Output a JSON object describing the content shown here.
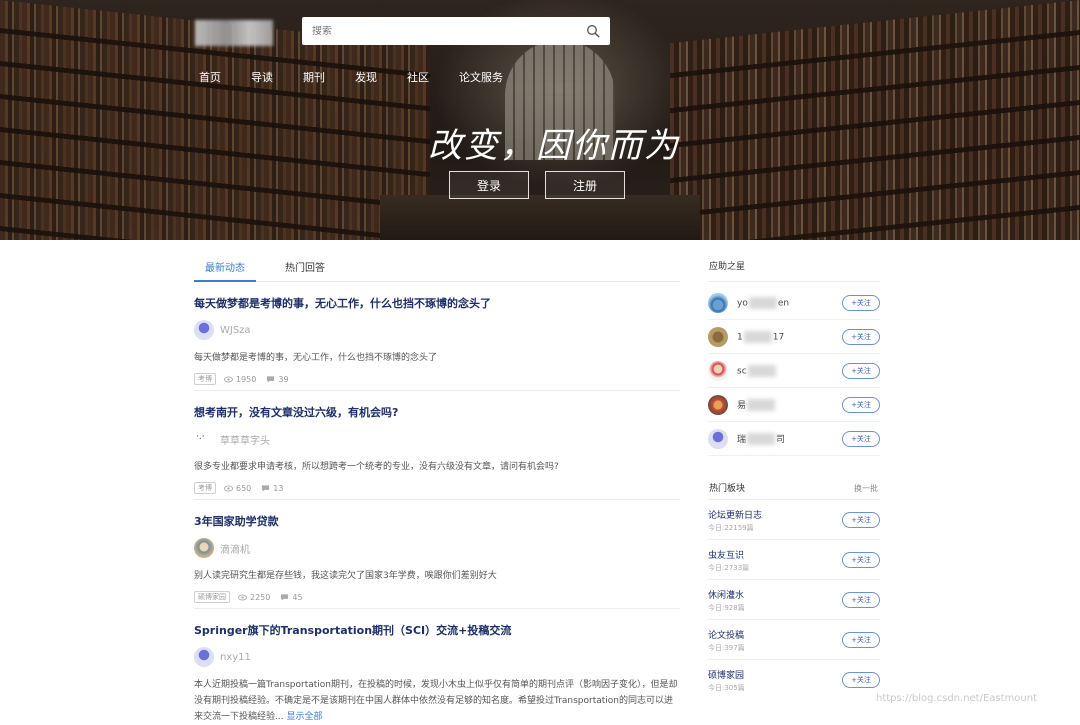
{
  "search": {
    "placeholder": "搜索"
  },
  "nav": [
    {
      "label": "首页"
    },
    {
      "label": "导读"
    },
    {
      "label": "期刊"
    },
    {
      "label": "发现"
    },
    {
      "label": "社区"
    },
    {
      "label": "论文服务"
    }
  ],
  "hero": {
    "slogan": "改变，因你而为",
    "login_label": "登录",
    "register_label": "注册"
  },
  "tabs": [
    {
      "label": "最新动态",
      "active": true
    },
    {
      "label": "热门回答",
      "active": false
    }
  ],
  "posts": [
    {
      "title": "每天做梦都是考博的事，无心工作，什么也挡不琢博的念头了",
      "author": "WJSza",
      "excerpt": "每天做梦都是考博的事，无心工作，什么也挡不琢博的念头了",
      "tag": "考博",
      "views": "1950",
      "comments": "39"
    },
    {
      "title": "想考南开，没有文章没过六级，有机会吗?",
      "author": "草草草字头",
      "excerpt": "很多专业都要求申请考核，所以想跨考一个统考的专业，没有六级没有文章，请问有机会吗?",
      "tag": "考博",
      "views": "650",
      "comments": "13"
    },
    {
      "title": "3年国家助学贷款",
      "author": "滴滴机",
      "excerpt": "别人读完研究生都是存些钱，我这读完欠了国家3年学费，唉跟你们差别好大",
      "tag": "硕博家园",
      "views": "2250",
      "comments": "45"
    },
    {
      "title": "Springer旗下的Transportation期刊（SCI）交流+投稿交流",
      "author": "nxy11",
      "excerpt": "本人近期投稿一篇Transportation期刊，在投稿的时候，发现小木虫上似乎仅有简单的期刊点评（影响因子变化），但是却没有期刊投稿经验。不确定是不是该期刊在中国人群体中依然没有足够的知名度。希望投过Transportation的同志可以进来交流一下投稿经验...",
      "more": "显示全部"
    }
  ],
  "sidebar": {
    "helpers_title": "应助之星",
    "helpers": [
      {
        "name_prefix": "yo",
        "name_suffix": "en",
        "follow": "+关注"
      },
      {
        "name_prefix": "1",
        "name_suffix": "17",
        "follow": "+关注"
      },
      {
        "name_prefix": "sc",
        "name_suffix": "",
        "follow": "+关注"
      },
      {
        "name_prefix": "易",
        "name_suffix": "",
        "follow": "+关注"
      },
      {
        "name_prefix": "瑞",
        "name_suffix": "司",
        "follow": "+关注"
      }
    ],
    "boards_title": "热门板块",
    "swap_label": "换一批",
    "boards": [
      {
        "name": "论坛更新日志",
        "count": "今日:22159篇",
        "follow": "+关注"
      },
      {
        "name": "虫友互识",
        "count": "今日:2733篇",
        "follow": "+关注"
      },
      {
        "name": "休闲灌水",
        "count": "今日:928篇",
        "follow": "+关注"
      },
      {
        "name": "论文投稿",
        "count": "今日:397篇",
        "follow": "+关注"
      },
      {
        "name": "硕博家园",
        "count": "今日:305篇",
        "follow": "+关注"
      }
    ]
  },
  "watermark": "https://blog.csdn.net/Eastmount"
}
